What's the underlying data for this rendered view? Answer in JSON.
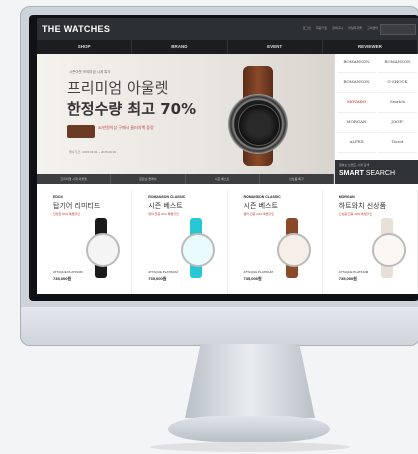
{
  "site": {
    "logo": "THE WATCHES",
    "util_links": [
      "로그인",
      "회원가입",
      "장바구니",
      "마일리지몰",
      "고객센터"
    ]
  },
  "nav": [
    "SHOP",
    "BRAND",
    "EVENT",
    "REVIEWER"
  ],
  "hero": {
    "small_text": "시즌아웃 프리미엄 시계 특가",
    "title_line1": "프리미엄 아울렛",
    "title_line2": "한정수량 최고 70%",
    "promo_text": "30만원이상 구매시 클러치백 증정",
    "date_text": "행사기간 : 2015.09.01 ~ 2015.09.30",
    "tabs": [
      "프리미엄 시계 아울렛",
      "로만손 클래식",
      "시즌 베스트",
      "신상품 특가"
    ]
  },
  "brand_panel": {
    "brands": [
      "ROMANSON",
      "ROMANSON",
      "ROMANSON",
      "G-SHOCK",
      "MOVADO",
      "Swatch",
      "MORGAN",
      "JOOP!",
      "ALFEX",
      "Tissot",
      "SECTOR",
      "Festina"
    ],
    "smart_small": "원하는 브랜드 시계 검색",
    "smart_title_bold": "SMART",
    "smart_title_rest": " SEARCH"
  },
  "products": [
    {
      "cat": "EDOX",
      "title": "탑기어 리미티드",
      "red": "한정판 50% 특별할인",
      "name": "ATTAQUE PLATINUM",
      "price": "735,000원",
      "band_color": "#1a1a1a",
      "case_color": "#f4f4f4"
    },
    {
      "cat": "ROMANSON CLASSIC",
      "title": "시즌 베스트",
      "red": "썸머 전용 20% 특별할인",
      "name": "ATTAQUE PLATINUM",
      "price": "735,000원",
      "band_color": "#28c7d6",
      "case_color": "#e9fbfd"
    },
    {
      "cat": "ROMANSON CLASSIC",
      "title": "시즌 베스트",
      "red": "썸머 전용 20% 특별할인",
      "name": "ATTAQUE PLATINUM",
      "price": "735,000원",
      "band_color": "#8a4a2a",
      "case_color": "#f6efe8"
    },
    {
      "cat": "MORGAN",
      "title": "하트와치 신상품",
      "red": "신상품 전용 20% 특별할인",
      "name": "ATTAQUE PLATINUM",
      "price": "735,000원",
      "band_color": "#e8e0d6",
      "case_color": "#fbf8f3"
    }
  ]
}
